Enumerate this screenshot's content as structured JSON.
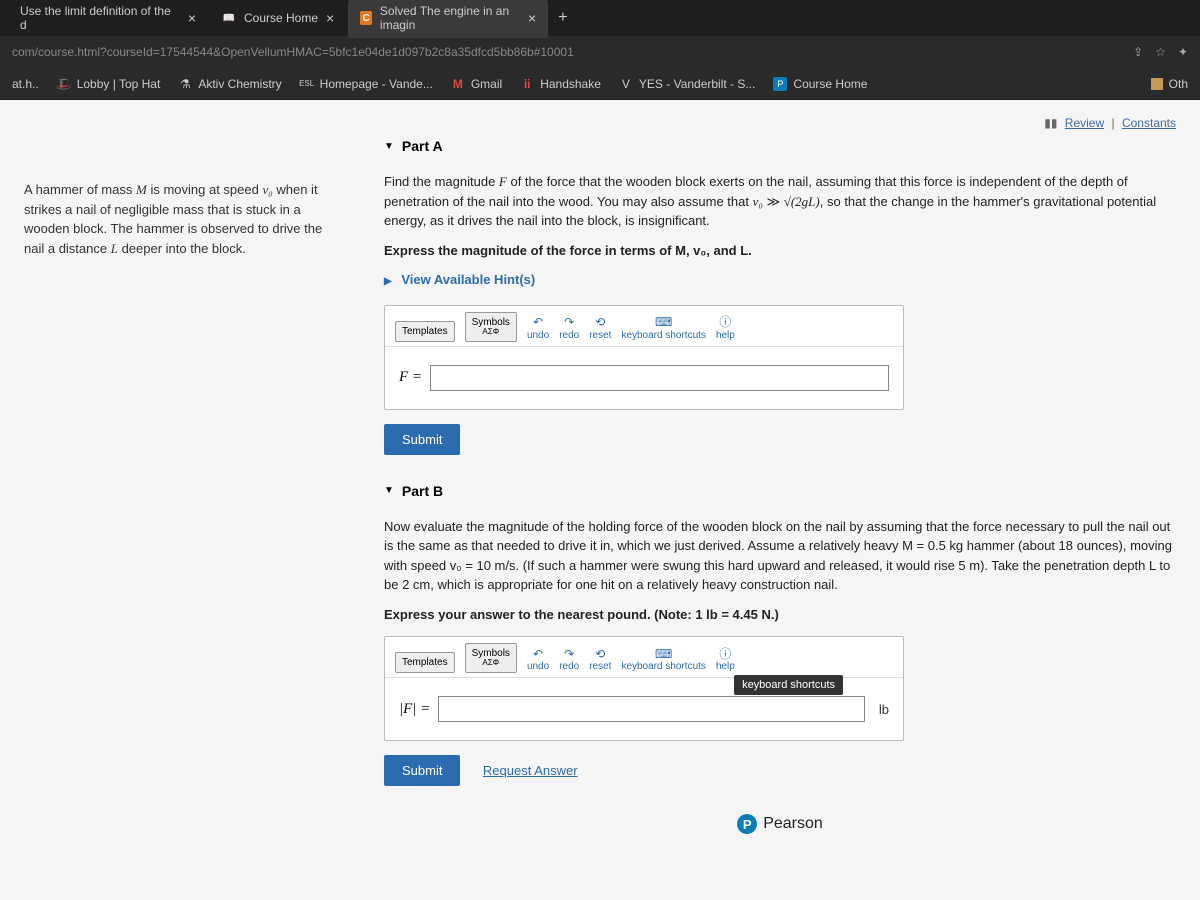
{
  "browser": {
    "tabs": [
      {
        "title": "Use the limit definition of the d",
        "icon": "",
        "active": false
      },
      {
        "title": "Course Home",
        "icon": "📖",
        "active": false
      },
      {
        "title": "Solved The engine in an imagin",
        "icon": "C",
        "active": true
      }
    ],
    "new_tab": "+",
    "url": "com/course.html?courseId=17544544&OpenVellumHMAC=5bfc1e04de1d097b2c8a35dfcd5bb86b#10001",
    "bookmarks": [
      {
        "label": "at.h..",
        "icon": ""
      },
      {
        "label": "Lobby | Top Hat",
        "icon": "🎩"
      },
      {
        "label": "Aktiv Chemistry",
        "icon": "⚗"
      },
      {
        "label": "Homepage - Vande...",
        "icon": "ESL"
      },
      {
        "label": "Gmail",
        "icon": "M"
      },
      {
        "label": "Handshake",
        "icon": "ii"
      },
      {
        "label": "YES - Vanderbilt - S...",
        "icon": "V"
      },
      {
        "label": "Course Home",
        "icon": "P"
      }
    ],
    "other": "Oth"
  },
  "top_links": {
    "review": "Review",
    "constants": "Constants"
  },
  "sidebar": {
    "text_before_M": "A hammer of mass ",
    "M": "M",
    "text_mid1": " is moving at speed ",
    "v0": "v₀",
    "text_mid2": " when it strikes a nail of negligible mass that is stuck in a wooden block. The hammer is observed to drive the nail a distance ",
    "L": "L",
    "text_end": " deeper into the block."
  },
  "partA": {
    "header": "Part A",
    "prompt1": "Find the magnitude ",
    "F": "F",
    "prompt2": " of the force that the wooden block exerts on the nail, assuming that this force is independent of the depth of penetration of the nail into the wood. You may also assume that ",
    "ineq_lhs": "v₀",
    "ineq": " ≫ ",
    "ineq_rhs": "√(2gL)",
    "prompt3": ", so that the change in the hammer's gravitational potential energy, as it drives the nail into the block, is insignificant.",
    "express": "Express the magnitude of the force in terms of M, v₀, and L.",
    "hints": "View Available Hint(s)",
    "lhs": "F =",
    "submit": "Submit"
  },
  "partB": {
    "header": "Part B",
    "prompt": "Now evaluate the magnitude of the holding force of the wooden block on the nail by assuming that the force necessary to pull the nail out is the same as that needed to drive it in, which we just derived. Assume a relatively heavy M = 0.5 kg hammer (about 18 ounces), moving with speed v₀ = 10 m/s. (If such a hammer were swung this hard upward and released, it would rise 5 m). Take the penetration depth L to be 2 cm, which is appropriate for one hit on a relatively heavy construction nail.",
    "express": "Express your answer to the nearest pound. (Note: 1 lb = 4.45 N.)",
    "lhs": "|F| =",
    "unit": "lb",
    "tooltip": "keyboard shortcuts",
    "submit": "Submit",
    "request": "Request Answer"
  },
  "toolbar": {
    "templates": "Templates",
    "symbols": "Symbols",
    "symbols_sub": "ΑΣΦ",
    "undo": "undo",
    "redo": "redo",
    "reset": "reset",
    "keyboard": "keyboard shortcuts",
    "help": "help"
  },
  "footer": {
    "pearson": "Pearson"
  }
}
